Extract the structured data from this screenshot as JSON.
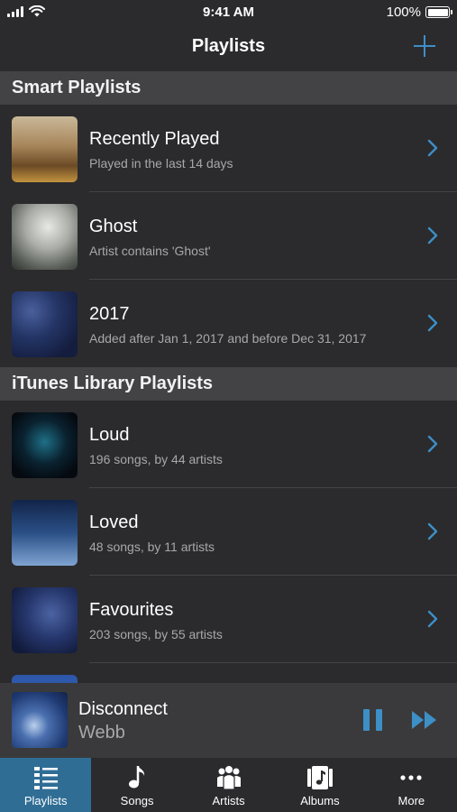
{
  "status_bar": {
    "time": "9:41 AM",
    "battery_text": "100%"
  },
  "nav": {
    "title": "Playlists",
    "add_icon": "plus-icon"
  },
  "sections": [
    {
      "header": "Smart Playlists",
      "items": [
        {
          "title": "Recently Played",
          "subtitle": "Played in the last 14 days"
        },
        {
          "title": "Ghost",
          "subtitle": "Artist contains 'Ghost'"
        },
        {
          "title": "2017",
          "subtitle": "Added after Jan 1, 2017 and before Dec 31, 2017"
        }
      ]
    },
    {
      "header": "iTunes Library Playlists",
      "items": [
        {
          "title": "Loud",
          "subtitle": "196 songs, by 44 artists"
        },
        {
          "title": "Loved",
          "subtitle": "48 songs, by 11 artists"
        },
        {
          "title": "Favourites",
          "subtitle": "203 songs, by 55 artists"
        }
      ]
    }
  ],
  "now_playing": {
    "title": "Disconnect",
    "artist": "Webb"
  },
  "tabs": [
    {
      "label": "Playlists",
      "icon": "list-icon",
      "active": true
    },
    {
      "label": "Songs",
      "icon": "music-note-icon",
      "active": false
    },
    {
      "label": "Artists",
      "icon": "people-icon",
      "active": false
    },
    {
      "label": "Albums",
      "icon": "album-icon",
      "active": false
    },
    {
      "label": "More",
      "icon": "more-icon",
      "active": false
    }
  ],
  "colors": {
    "accent": "#3d8fc6",
    "background": "#2b2b2d",
    "section_header": "#434345",
    "active_tab": "#2f6d95"
  }
}
